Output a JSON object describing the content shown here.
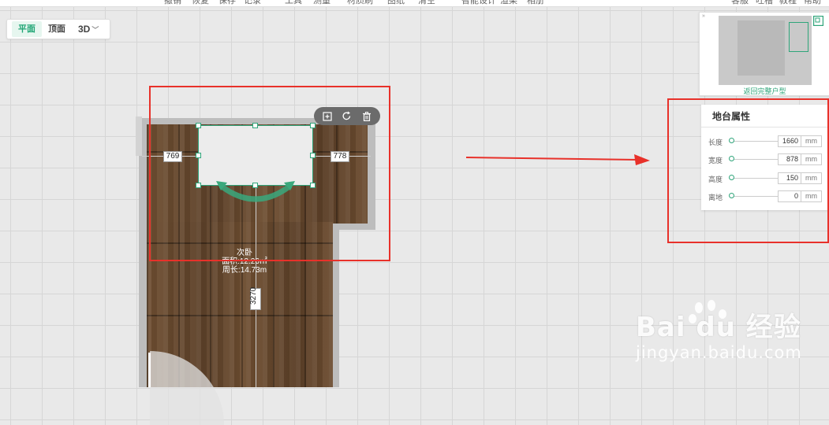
{
  "toolbar": {
    "items": [
      "撤销",
      "恢复",
      "保存",
      "记录",
      "工具",
      "测量",
      "材质刷",
      "图纸",
      "清空",
      "智能设计",
      "渲染",
      "相册",
      "客服",
      "吐槽",
      "教程",
      "帮助"
    ]
  },
  "view_tabs": {
    "plan": "平面",
    "ceiling": "顶面",
    "three_d": "3D"
  },
  "canvas": {
    "dim_left": "769",
    "dim_right": "778",
    "dim_vertical": "3270",
    "room_name": "次卧",
    "room_area": "面积:12.26㎡",
    "room_perimeter": "周长:14.73m"
  },
  "selection_tools": {
    "copy_icon": "copy-icon",
    "rotate_icon": "rotate-icon",
    "delete_icon": "trash-icon"
  },
  "minimap": {
    "back_link": "返回完整户型"
  },
  "properties": {
    "title": "地台属性",
    "rows": [
      {
        "label": "长度",
        "value": "1660",
        "unit": "mm",
        "level": 0.0
      },
      {
        "label": "宽度",
        "value": "878",
        "unit": "mm",
        "level": 0.0
      },
      {
        "label": "高度",
        "value": "150",
        "unit": "mm",
        "level": 0.0
      },
      {
        "label": "离地",
        "value": "0",
        "unit": "mm",
        "level": 0.0
      }
    ]
  },
  "watermark": {
    "brand": "Bai du 经验",
    "url": "jingyan.baidu.com"
  },
  "colors": {
    "accent": "#2fa57a",
    "highlight": "#e8312a"
  }
}
